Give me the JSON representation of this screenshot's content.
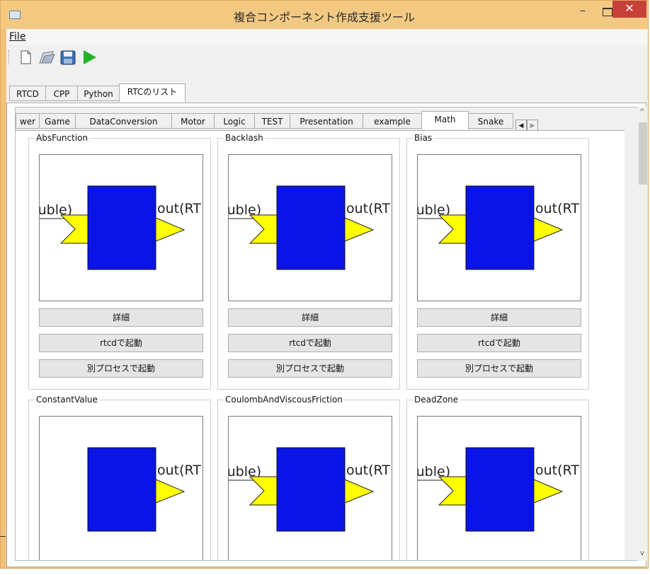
{
  "window": {
    "title": "複合コンポーネント作成支援ツール"
  },
  "menu": {
    "file": "File"
  },
  "toolbar": {
    "icons": [
      "new-file-icon",
      "open-folder-icon",
      "save-icon",
      "run-icon"
    ]
  },
  "outer_tabs": [
    {
      "label": "RTCD"
    },
    {
      "label": "CPP"
    },
    {
      "label": "Python"
    },
    {
      "label": "RTCのリスト"
    }
  ],
  "inner_tabs": [
    {
      "label": "wer"
    },
    {
      "label": "Game"
    },
    {
      "label": "DataConversion"
    },
    {
      "label": "Motor"
    },
    {
      "label": "Logic"
    },
    {
      "label": "TEST"
    },
    {
      "label": "Presentation"
    },
    {
      "label": "example"
    },
    {
      "label": "Math"
    },
    {
      "label": "Snake"
    }
  ],
  "buttons": {
    "detail": "詳細",
    "rtcd_launch": "rtcdで起動",
    "separate_launch": "別プロセスで起動"
  },
  "ports": {
    "in_label": "ouble)",
    "out_label": "out(RT"
  },
  "components": [
    {
      "name": "AbsFunction"
    },
    {
      "name": "Backlash"
    },
    {
      "name": "Bias"
    },
    {
      "name": "ConstantValue"
    },
    {
      "name": "CoulombAndViscousFriction"
    },
    {
      "name": "DeadZone"
    }
  ],
  "colors": {
    "block": "#0a14e6",
    "port": "#ffff00",
    "title_bar": "#f3c982",
    "close": "#c7413a"
  }
}
